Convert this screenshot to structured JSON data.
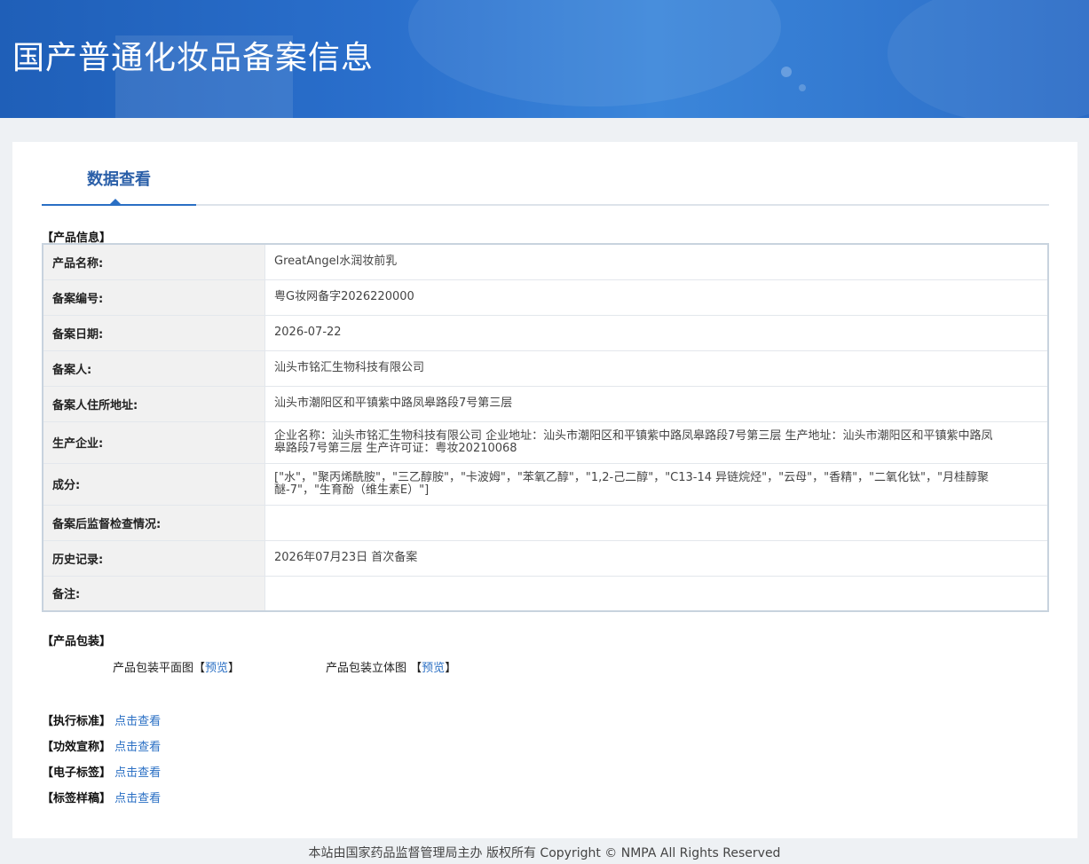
{
  "banner": {
    "title": "国产普通化妆品备案信息"
  },
  "tab": {
    "label": "数据查看"
  },
  "product_info": {
    "section_title": "【产品信息】",
    "rows": [
      {
        "label": "产品名称:",
        "value": "GreatAngel水润妆前乳"
      },
      {
        "label": "备案编号:",
        "value": "粤G妆网备字2026220000"
      },
      {
        "label": "备案日期:",
        "value": "2026-07-22"
      },
      {
        "label": "备案人:",
        "value": "汕头市铭汇生物科技有限公司"
      },
      {
        "label": "备案人住所地址:",
        "value": "汕头市潮阳区和平镇紫中路凤皋路段7号第三层"
      },
      {
        "label": "生产企业:",
        "value": "企业名称：汕头市铭汇生物科技有限公司 企业地址：汕头市潮阳区和平镇紫中路凤皋路段7号第三层 生产地址：汕头市潮阳区和平镇紫中路凤皋路段7号第三层 生产许可证：粤妆20210068"
      },
      {
        "label": "成分:",
        "value": "[\"水\"，\"聚丙烯酰胺\"，\"三乙醇胺\"，\"卡波姆\"，\"苯氧乙醇\"，\"1,2-己二醇\"，\"C13-14 异链烷烃\"，\"云母\"，\"香精\"，\"二氧化钛\"，\"月桂醇聚醚-7\"，\"生育酚（维生素E）\"]"
      },
      {
        "label": "备案后监督检查情况:",
        "value": ""
      },
      {
        "label": "历史记录:",
        "value": "2026年07月23日 首次备案"
      },
      {
        "label": "备注:",
        "value": ""
      }
    ]
  },
  "packaging": {
    "section_title": "【产品包装】",
    "flat_label": "产品包装平面图",
    "flat_bracket_open": "【",
    "flat_link": "预览",
    "flat_bracket_close": "】",
    "solid_label": "产品包装立体图",
    "solid_bracket_open": "【",
    "solid_link": "预览",
    "solid_bracket_close": "】"
  },
  "documents": [
    {
      "label": "【执行标准】",
      "link": "点击查看"
    },
    {
      "label": "【功效宣称】",
      "link": "点击查看"
    },
    {
      "label": "【电子标签】",
      "link": "点击查看"
    },
    {
      "label": "【标签样稿】",
      "link": "点击查看"
    }
  ],
  "footer": {
    "text": "本站由国家药品监督管理局主办 版权所有 Copyright © NMPA All Rights Reserved"
  }
}
